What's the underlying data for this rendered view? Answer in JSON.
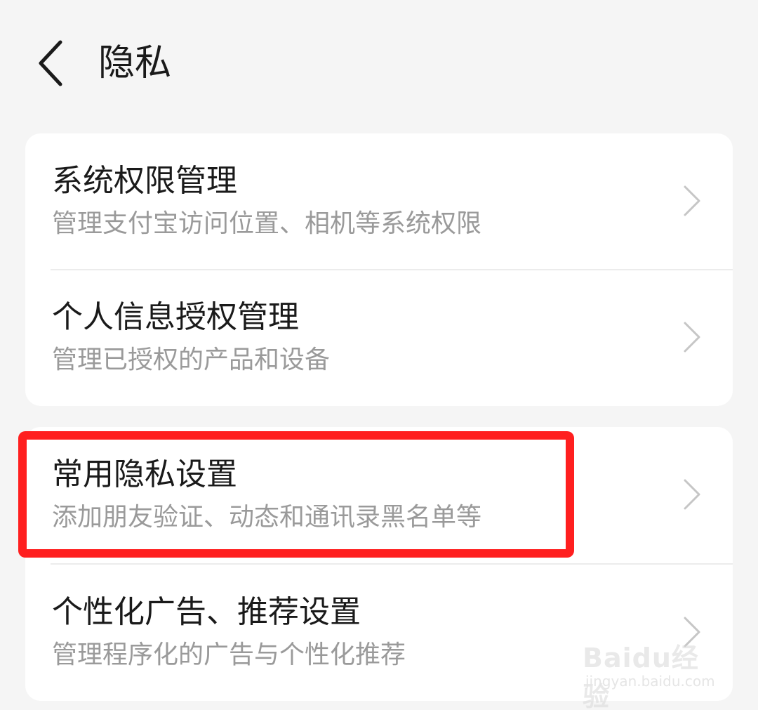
{
  "header": {
    "title": "隐私",
    "back_icon": "chevron-left-icon"
  },
  "groups": [
    {
      "items": [
        {
          "title": "系统权限管理",
          "subtitle": "管理支付宝访问位置、相机等系统权限",
          "icon": "chevron-right-icon"
        },
        {
          "title": "个人信息授权管理",
          "subtitle": "管理已授权的产品和设备",
          "icon": "chevron-right-icon"
        }
      ]
    },
    {
      "items": [
        {
          "title": "常用隐私设置",
          "subtitle": "添加朋友验证、动态和通讯录黑名单等",
          "icon": "chevron-right-icon",
          "highlighted": true
        },
        {
          "title": "个性化广告、推荐设置",
          "subtitle": "管理程序化的广告与个性化推荐",
          "icon": "chevron-right-icon"
        }
      ]
    }
  ],
  "annotation": {
    "highlight_color": "#ff1f1f"
  },
  "watermark": {
    "logo_text": "Baidu经验",
    "url": "jingyan.baidu.com"
  }
}
